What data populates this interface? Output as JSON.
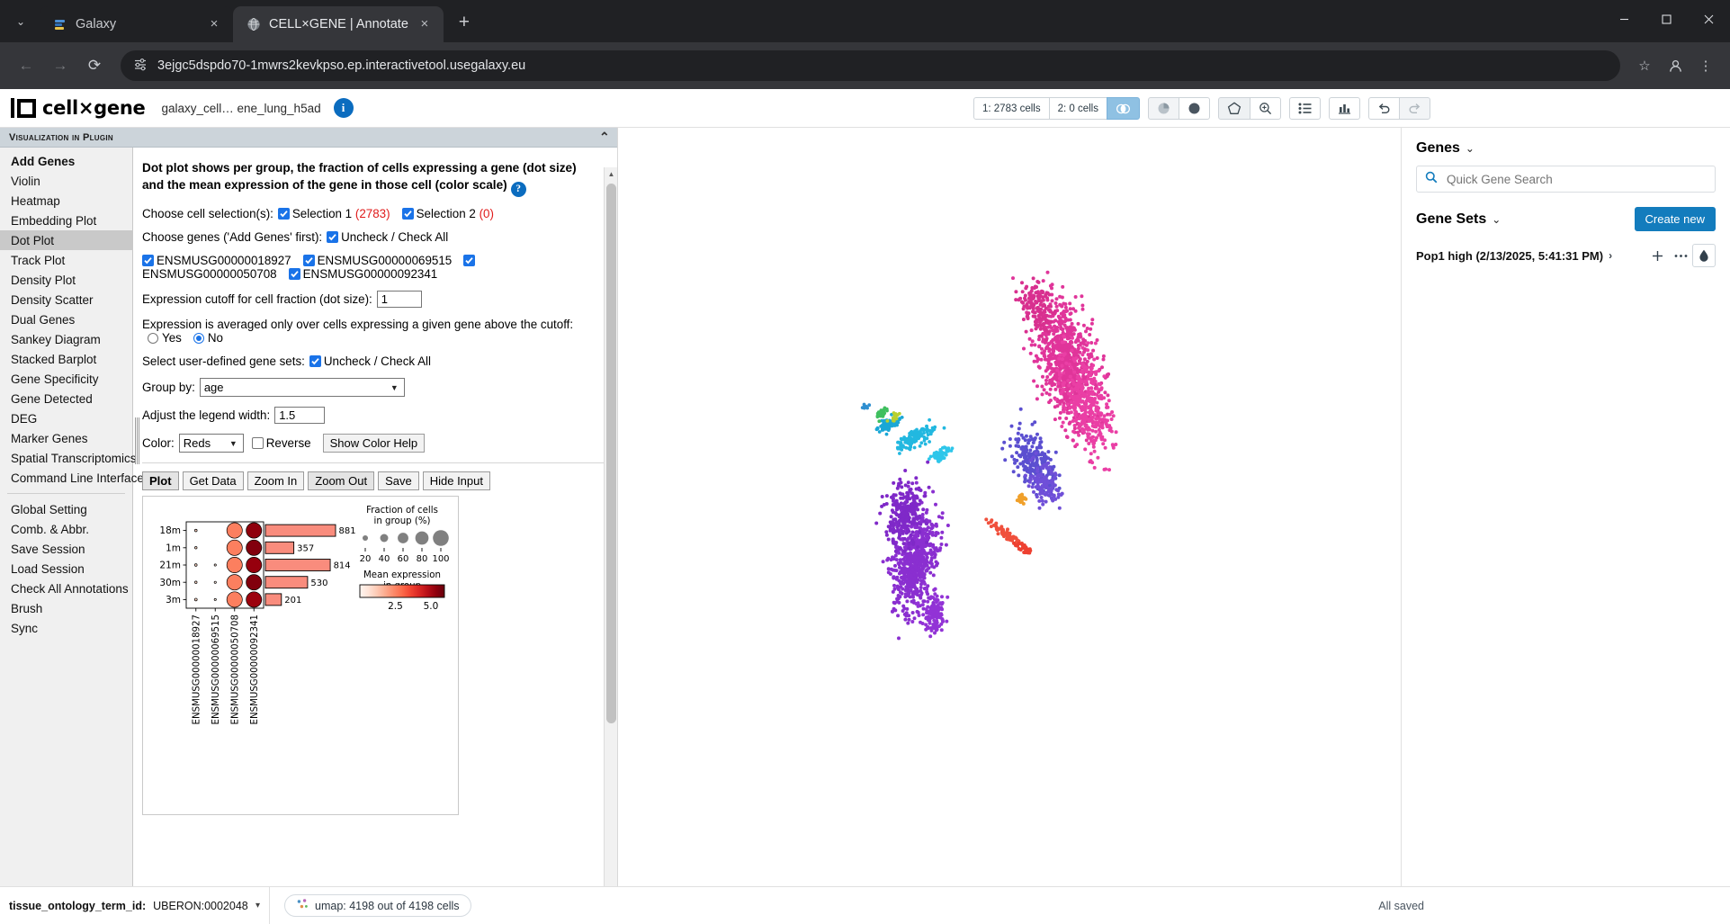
{
  "browser": {
    "tabs": [
      {
        "title": "Galaxy",
        "active": false,
        "favicon": "galaxy-icon"
      },
      {
        "title": "CELL×GENE | Annotate",
        "active": true,
        "favicon": "globe-icon"
      }
    ],
    "new_tab_label": "+",
    "close_label": "×",
    "url": "3ejgc5dspdo70-1mwrs2kevkpso.ep.interactivetool.usegalaxy.eu",
    "window_controls": {
      "minimize": "—",
      "maximize": "▢",
      "close": "✕"
    },
    "nav": {
      "back": "←",
      "forward": "→",
      "reload": "⟳",
      "bookmark": "☆",
      "profile": "profile-icon",
      "menu": "⋮"
    }
  },
  "app": {
    "logo_text": "cell×gene",
    "dataset_name": "galaxy_cell… ene_lung_h5ad",
    "info_label": "i"
  },
  "toolbar": {
    "selection1": "1: 2783 cells",
    "selection2": "2: 0 cells",
    "intersect_icon": "venn-intersect-icon",
    "pie_icon": "pie-chart-icon",
    "circle_icon": "filled-circle-icon",
    "lasso_icon": "lasso-select-icon",
    "zoom_icon": "zoom-pan-icon",
    "list_icon": "list-view-icon",
    "bar_icon": "bar-chart-icon",
    "undo_icon": "undo-icon",
    "redo_icon": "redo-icon"
  },
  "plugin": {
    "title": "Visualization in Plugin",
    "collapse_icon": "chevron-up-icon",
    "menu": [
      {
        "label": "Add Genes",
        "bold": true,
        "selected": false
      },
      {
        "label": "Violin",
        "bold": false,
        "selected": false
      },
      {
        "label": "Heatmap",
        "bold": false,
        "selected": false
      },
      {
        "label": "Embedding Plot",
        "bold": false,
        "selected": false
      },
      {
        "label": "Dot Plot",
        "bold": false,
        "selected": true
      },
      {
        "label": "Track Plot",
        "bold": false,
        "selected": false
      },
      {
        "label": "Density Plot",
        "bold": false,
        "selected": false
      },
      {
        "label": "Density Scatter",
        "bold": false,
        "selected": false
      },
      {
        "label": "Dual Genes",
        "bold": false,
        "selected": false
      },
      {
        "label": "Sankey Diagram",
        "bold": false,
        "selected": false
      },
      {
        "label": "Stacked Barplot",
        "bold": false,
        "selected": false
      },
      {
        "label": "Gene Specificity",
        "bold": false,
        "selected": false
      },
      {
        "label": "Gene Detected",
        "bold": false,
        "selected": false
      },
      {
        "label": "DEG",
        "bold": false,
        "selected": false
      },
      {
        "label": "Marker Genes",
        "bold": false,
        "selected": false
      },
      {
        "label": "Spatial Transcriptomics",
        "bold": false,
        "selected": false
      },
      {
        "label": "Command Line Interface",
        "bold": false,
        "selected": false
      }
    ],
    "menu2": [
      {
        "label": "Global Setting"
      },
      {
        "label": "Comb. & Abbr."
      },
      {
        "label": "Save Session"
      },
      {
        "label": "Load Session"
      },
      {
        "label": "Check All Annotations"
      },
      {
        "label": "Brush"
      },
      {
        "label": "Sync"
      }
    ]
  },
  "form": {
    "description_line1": "Dot plot shows per group, the fraction of cells expressing a gene (dot size) and the mean",
    "description_line2": "expression of the gene in those cell (color scale)",
    "help_badge": "?",
    "cell_selection_label": "Choose cell selection(s):",
    "selection1_label": "Selection 1",
    "selection1_count": "(2783)",
    "selection2_label": "Selection 2",
    "selection2_count": "(0)",
    "choose_genes_label": "Choose genes ('Add Genes' first):",
    "uncheck_check_all": "Uncheck / Check All",
    "genes": [
      "ENSMUSG00000018927",
      "ENSMUSG00000069515",
      "ENSMUSG00000050708",
      "ENSMUSG00000092341"
    ],
    "cutoff_label": "Expression cutoff for cell fraction (dot size):",
    "cutoff_value": "1",
    "averaged_label": "Expression is averaged only over cells expressing a given gene above the cutoff:",
    "yes_label": "Yes",
    "no_label": "No",
    "averaged_value": "No",
    "gene_sets_label": "Select user-defined gene sets:",
    "group_by_label": "Group by:",
    "group_by_value": "age",
    "legend_width_label": "Adjust the legend width:",
    "legend_width_value": "1.5",
    "color_label": "Color:",
    "color_value": "Reds",
    "reverse_label": "Reverse",
    "show_color_help": "Show Color Help",
    "buttons": [
      "Plot",
      "Get Data",
      "Zoom In",
      "Zoom Out",
      "Save",
      "Hide Input"
    ]
  },
  "chart_data": {
    "type": "bar",
    "title": "",
    "categories": [
      "18m",
      "1m",
      "21m",
      "30m",
      "3m"
    ],
    "values": [
      881,
      357,
      814,
      530,
      201
    ],
    "xlabel": "",
    "ylabel": "",
    "bar_color": "#f98c7d",
    "dotplot": {
      "genes": [
        "ENSMUSG00000018927",
        "ENSMUSG00000069515",
        "ENSMUSG00000050708",
        "ENSMUSG00000092341"
      ],
      "groups": [
        "18m",
        "1m",
        "21m",
        "30m",
        "3m"
      ],
      "fraction_pct": [
        [
          5,
          0,
          100,
          100
        ],
        [
          4,
          0,
          100,
          100
        ],
        [
          5,
          2,
          100,
          100
        ],
        [
          4,
          2,
          100,
          100
        ],
        [
          6,
          2,
          100,
          100
        ]
      ],
      "mean_expression": [
        [
          1.0,
          0.0,
          2.6,
          5.4
        ],
        [
          1.0,
          0.0,
          2.6,
          5.6
        ],
        [
          1.0,
          0.5,
          2.6,
          5.3
        ],
        [
          1.0,
          0.5,
          2.6,
          5.6
        ],
        [
          1.0,
          0.5,
          2.6,
          5.2
        ]
      ]
    },
    "legend": {
      "size_title_line1": "Fraction of cells",
      "size_title_line2": "in group (%)",
      "size_ticks": [
        "20",
        "40",
        "60",
        "80",
        "100"
      ],
      "color_title_line1": "Mean expression",
      "color_title_line2": "in group",
      "color_ticks": [
        "2.5",
        "5.0"
      ],
      "colormap": "Reds"
    }
  },
  "genes_panel": {
    "genes_title": "Genes",
    "chevron": "⌄",
    "search_placeholder": "Quick Gene Search",
    "search_icon": "search-icon",
    "gene_sets_title": "Gene Sets",
    "create_new": "Create new",
    "gene_set_name": "Pop1 high (2/13/2025, 5:41:31 PM)",
    "expand_chevron": "›",
    "add_icon": "plus-icon",
    "more_icon": "ellipsis-icon",
    "color_icon": "droplet-icon"
  },
  "status_bar": {
    "ontology_label": "tissue_ontology_term_id:",
    "ontology_value": "UBERON:0002048",
    "expand_icon": "chevron-down-icon",
    "umap_icon": "umap-icon",
    "umap_text": "umap: 4198 out of 4198 cells",
    "saved_text": "All saved"
  }
}
